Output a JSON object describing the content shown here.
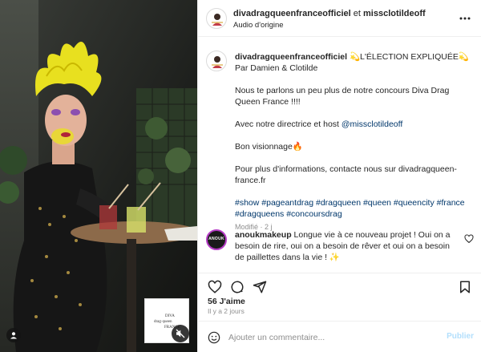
{
  "header": {
    "user1": "divadragqueenfranceofficiel",
    "connector": "et",
    "user2": "missclotildeoff",
    "audio": "Audio d'origine",
    "more_icon": "more-horizontal-icon"
  },
  "caption": {
    "username": "divadragqueenfranceofficiel",
    "title": "💫L'ÉLECTION EXPLIQUÉE💫",
    "line_by": "Par Damien & Clotilde",
    "paragraph1": "Nous te parlons un peu plus de notre concours Diva Drag Queen France !!!!",
    "paragraph2_text": "Avec notre directrice et host ",
    "paragraph2_mention": "@missclotildeoff",
    "paragraph3": "Bon visionnage🔥",
    "paragraph4": "Pour plus d'informations, contacte nous sur divadragqueen-france.fr",
    "hashtags": "#show #pageantdrag #dragqueen #queen #queencity #france #dragqueens #concoursdrag",
    "meta": "Modifié · 2 j"
  },
  "comment": {
    "username": "anoukmakeup",
    "text": "Longue vie à ce nouveau projet ! Oui on a besoin de rire, oui on a besoin de rêver et oui on a besoin de paillettes dans la vie ! ✨",
    "avatar_text": "ANOUK"
  },
  "stats": {
    "likes": "56 J'aime",
    "time": "Il y a 2 jours"
  },
  "composer": {
    "placeholder": "Ajouter un commentaire...",
    "publish": "Publier"
  },
  "media": {
    "logo_line1": "DIVA",
    "logo_line2": "drag·queen",
    "logo_line3": "FRANCE"
  },
  "colors": {
    "link": "#00376b",
    "muted": "#8e8e8e",
    "publish_disabled": "#b2dffc",
    "wig_yellow": "#e8e01f"
  }
}
